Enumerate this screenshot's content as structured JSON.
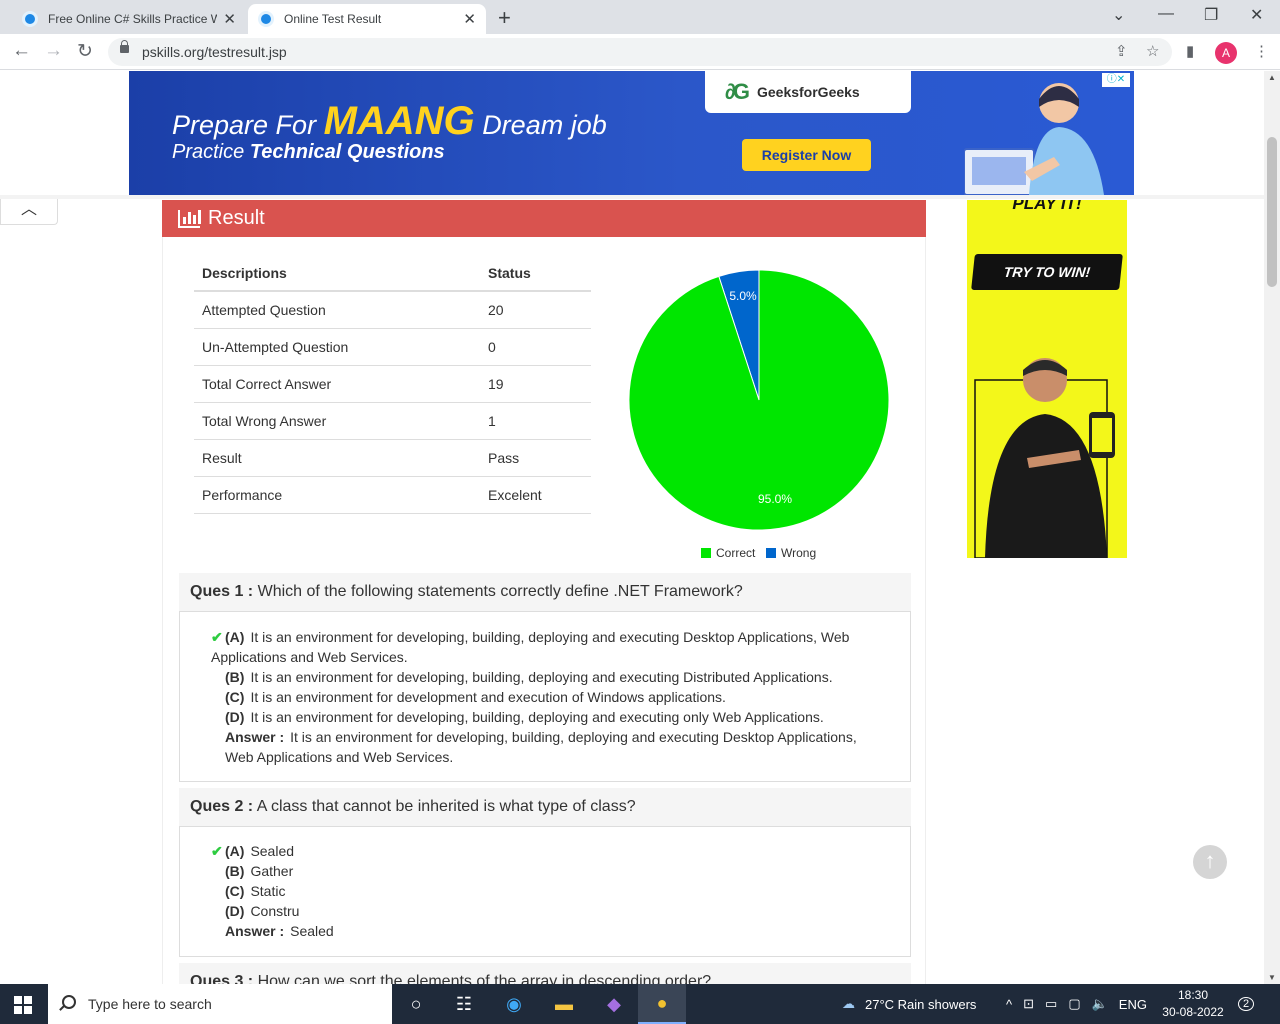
{
  "browser": {
    "tabs": [
      {
        "title": "Free Online C# Skills Practice Wri",
        "active": false
      },
      {
        "title": "Online Test Result",
        "active": true
      }
    ],
    "url": "pskills.org/testresult.jsp",
    "profile_initial": "A"
  },
  "ad_banner": {
    "line1_prefix": "Prepare For",
    "line1_highlight": "MAANG",
    "line1_suffix": "Dream job",
    "line2_prefix": "Practice",
    "line2_bold": "Technical Questions",
    "brand": "GeeksforGeeks",
    "brand_mark": "∂G",
    "cta": "Register Now",
    "colors": {
      "background": "#2b57c9",
      "highlight": "#ffd21f"
    }
  },
  "result": {
    "title": "Result",
    "header_color": "#d9534f",
    "table_headers": [
      "Descriptions",
      "Status"
    ],
    "rows": [
      {
        "label": "Attempted Question",
        "value": "20"
      },
      {
        "label": "Un-Attempted Question",
        "value": "0"
      },
      {
        "label": "Total Correct Answer",
        "value": "19"
      },
      {
        "label": "Total Wrong Answer",
        "value": "1"
      },
      {
        "label": "Result",
        "value": "Pass"
      },
      {
        "label": "Performance",
        "value": "Excelent"
      }
    ]
  },
  "chart_data": {
    "type": "pie",
    "slices": [
      {
        "name": "Correct",
        "value": 95.0,
        "label": "95.0%",
        "color": "#00e600"
      },
      {
        "name": "Wrong",
        "value": 5.0,
        "label": "5.0%",
        "color": "#0066cc"
      }
    ],
    "legend_position": "bottom"
  },
  "questions": [
    {
      "number_label": "Ques 1 :",
      "text": "Which of the following statements correctly define .NET Framework?",
      "options": [
        {
          "letter": "(A)",
          "text": "It is an environment for developing, building, deploying and executing Desktop Applications, Web Applications and Web Services.",
          "correct": true
        },
        {
          "letter": "(B)",
          "text": "It is an environment for developing, building, deploying and executing Distributed Applications.",
          "correct": false
        },
        {
          "letter": "(C)",
          "text": "It is an environment for development and execution of Windows applications.",
          "correct": false
        },
        {
          "letter": "(D)",
          "text": "It is an environment for developing, building, deploying and executing only Web Applications.",
          "correct": false
        }
      ],
      "answer_label": "Answer :",
      "answer": "It is an environment for developing, building, deploying and executing Desktop Applications, Web Applications and Web Services."
    },
    {
      "number_label": "Ques 2 :",
      "text": "A class that cannot be inherited is what type of class?",
      "options": [
        {
          "letter": "(A)",
          "text": "Sealed",
          "correct": true
        },
        {
          "letter": "(B)",
          "text": "Gather",
          "correct": false
        },
        {
          "letter": "(C)",
          "text": "Static",
          "correct": false
        },
        {
          "letter": "(D)",
          "text": "Constru",
          "correct": false
        }
      ],
      "answer_label": "Answer :",
      "answer": "Sealed"
    },
    {
      "number_label": "Ques 3 :",
      "text": "How can we sort the elements of the array in descending order?"
    }
  ],
  "side_ad": {
    "top_text": "PLAY IT!",
    "cta": "TRY TO WIN!",
    "color": "#f3f71a"
  },
  "taskbar": {
    "search_placeholder": "Type here to search",
    "weather": "27°C  Rain showers",
    "language": "ENG",
    "time": "18:30",
    "date": "30-08-2022",
    "notification_count": "2"
  }
}
